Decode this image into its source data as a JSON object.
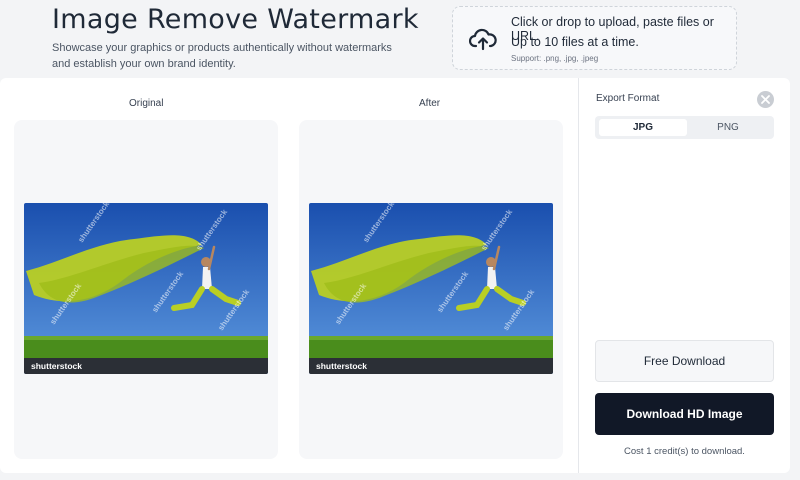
{
  "header": {
    "title": "Image Remove Watermark",
    "subtitle": "Showcase your graphics or products authentically without watermarks and establish your own brand identity."
  },
  "upload": {
    "icon": "upload-cloud-icon",
    "line1": "Click or drop to upload, paste files or URL.",
    "line2": "Up to 10 files at a time.",
    "support": "Support: .png, .jpg, .jpeg"
  },
  "preview": {
    "original_label": "Original",
    "after_label": "After",
    "watermark_text": "shutterstock"
  },
  "export": {
    "label": "Export Format",
    "formats": [
      "JPG",
      "PNG"
    ],
    "selected": "JPG",
    "free_download": "Free Download",
    "hd_download": "Download HD Image",
    "cost_note": "Cost 1 credit(s) to download."
  },
  "colors": {
    "primary_dark": "#111827",
    "sky": "#1f5fbf",
    "grass": "#4f8f1f",
    "scarf": "#b7cc22"
  }
}
